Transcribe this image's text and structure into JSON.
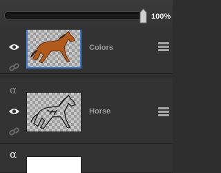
{
  "toolbar": {
    "opacity_value": "100%",
    "opacity": 1.0
  },
  "layers": [
    {
      "name": "Colors",
      "visible": true,
      "selected": true,
      "thumbnail": "brown-horse"
    },
    {
      "name": "Horse",
      "visible": true,
      "selected": false,
      "thumbnail": "horse-sketch"
    },
    {
      "name": "",
      "visible": false,
      "selected": false,
      "thumbnail": "white-background"
    }
  ],
  "icons": {
    "alpha_lock": "α",
    "visibility": "eye-icon",
    "link": "link-icon",
    "menu": "hamburger-icon"
  },
  "colors": {
    "selection_border": "#3a7bd5",
    "background": "#2e2e2e"
  }
}
